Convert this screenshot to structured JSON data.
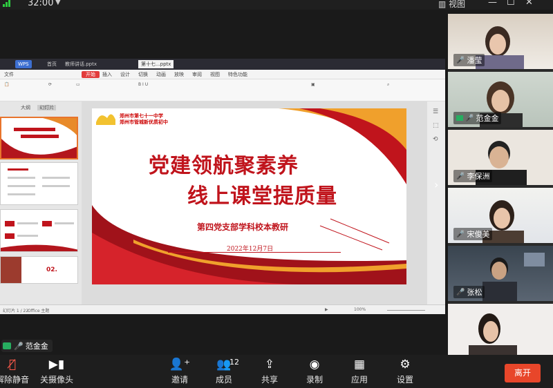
{
  "topbar": {
    "timer": "32:00",
    "view_label": "视图"
  },
  "wps": {
    "tabs": [
      "WPS",
      "首页",
      "教师讲话.pptx",
      "第十七...pptx"
    ],
    "menus": [
      "文件",
      "开始",
      "插入",
      "设计",
      "切换",
      "动画",
      "放映",
      "审阅",
      "视图",
      "特色功能"
    ],
    "start_menu": "开始",
    "thumb_tabs": [
      "大纲",
      "幻灯片"
    ],
    "status": {
      "slide": "幻灯片 1 / 22",
      "theme": "Office 主题",
      "zoom": "100%"
    }
  },
  "slide": {
    "school_line1": "郑州市第七十一中学",
    "school_line2": "郑州市管城新优质初中",
    "title_line1": "党建领航聚素养",
    "title_line2": "线上课堂提质量",
    "subtitle": "第四党支部学科校本教研",
    "date": "2022年12月7日",
    "thumb_label_4": "02."
  },
  "speaker": {
    "name": "范金金"
  },
  "participants": [
    {
      "name": "潘莹"
    },
    {
      "name": "范金金"
    },
    {
      "name": "李保洲"
    },
    {
      "name": "宋俊美"
    },
    {
      "name": "张松"
    },
    {
      "name": ""
    }
  ],
  "toolbar": {
    "mute": "解除静音",
    "video": "关摄像头",
    "invite": "邀请",
    "members": "成员",
    "members_count": "12",
    "share": "共享",
    "record": "录制",
    "apps": "应用",
    "settings": "设置",
    "leave": "离开"
  },
  "colors": {
    "brand_red": "#c0141c",
    "leave": "#e8462a",
    "active_cam": "#27ae60"
  }
}
